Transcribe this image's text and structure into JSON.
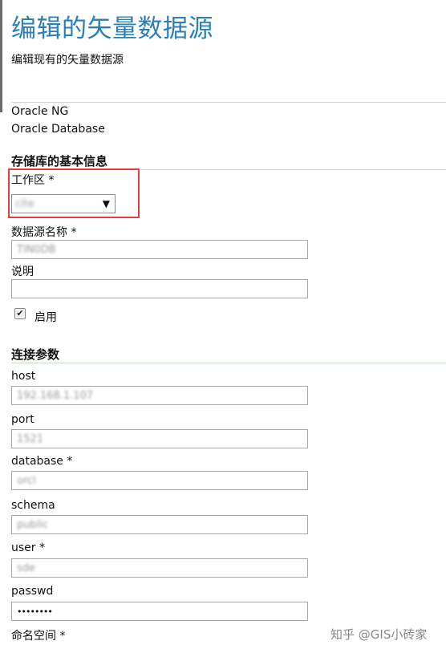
{
  "page": {
    "title": "编辑的矢量数据源",
    "subtitle": "编辑现有的矢量数据源"
  },
  "store_type": {
    "name": "Oracle NG",
    "description": "Oracle Database"
  },
  "basic_info": {
    "section_title": "存储库的基本信息",
    "workspace_label": "工作区 *",
    "workspace_value": "cite",
    "datasource_name_label": "数据源名称 *",
    "datasource_name_value": "TIN0DB",
    "description_label": "说明",
    "description_value": "",
    "enabled_label": "启用",
    "enabled_check": "✔"
  },
  "connection": {
    "section_title": "连接参数",
    "host_label": "host",
    "host_value": "192.168.1.107",
    "port_label": "port",
    "port_value": "1521",
    "database_label": "database *",
    "database_value": "orcl",
    "schema_label": "schema",
    "schema_value": "public",
    "user_label": "user *",
    "user_value": "sde",
    "passwd_label": "passwd",
    "passwd_value": "••••••••",
    "namespace_label": "命名空间 *"
  },
  "watermark": "知乎 @GIS小砖家",
  "icons": {
    "select_arrow": "▼"
  },
  "colors": {
    "title": "#2a7fb8",
    "highlight": "#e0403c",
    "divider": "#c8dcc0"
  }
}
